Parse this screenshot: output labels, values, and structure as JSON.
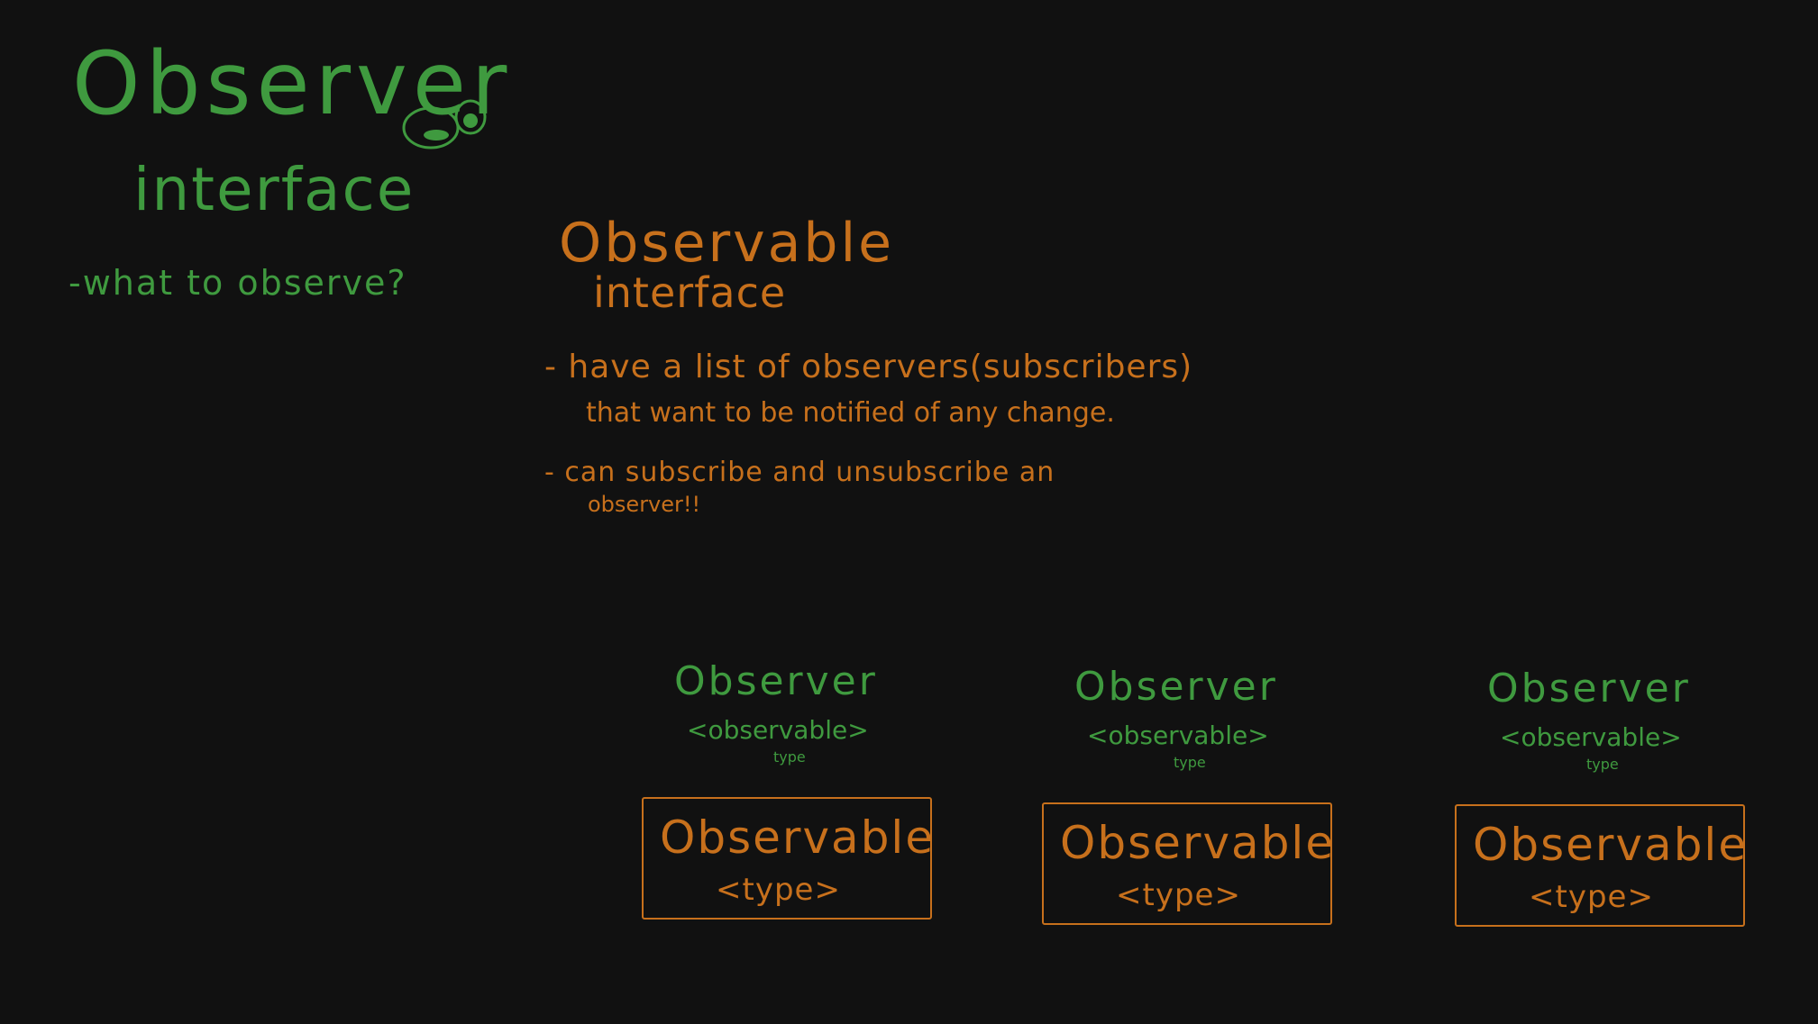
{
  "canvas": {
    "background": "#111111",
    "ink_colors": {
      "green": "#3f9a3f",
      "orange": "#c7701c"
    }
  },
  "observer_block": {
    "title": "Observer",
    "subtitle": "interface",
    "note": "-what to observe?",
    "doodle_icon": "eye-icon"
  },
  "observable_block": {
    "title": "Observable",
    "subtitle": "interface",
    "bullet_1_line_1": "- have a list of observers(subscribers)",
    "bullet_1_line_2": "that want to be notified of any change.",
    "bullet_2_line_1": "- can subscribe and unsubscribe an",
    "bullet_2_line_2": "observer!!"
  },
  "groups": [
    {
      "observer_title": "Observer",
      "observer_generic": "<observable>",
      "type_note": "type",
      "box_title": "Observable",
      "box_generic": "<type>"
    },
    {
      "observer_title": "Observer",
      "observer_generic": "<observable>",
      "type_note": "type",
      "box_title": "Observable",
      "box_generic": "<type>"
    },
    {
      "observer_title": "Observer",
      "observer_generic": "<observable>",
      "type_note": "type",
      "box_title": "Observable",
      "box_generic": "<type>"
    }
  ]
}
